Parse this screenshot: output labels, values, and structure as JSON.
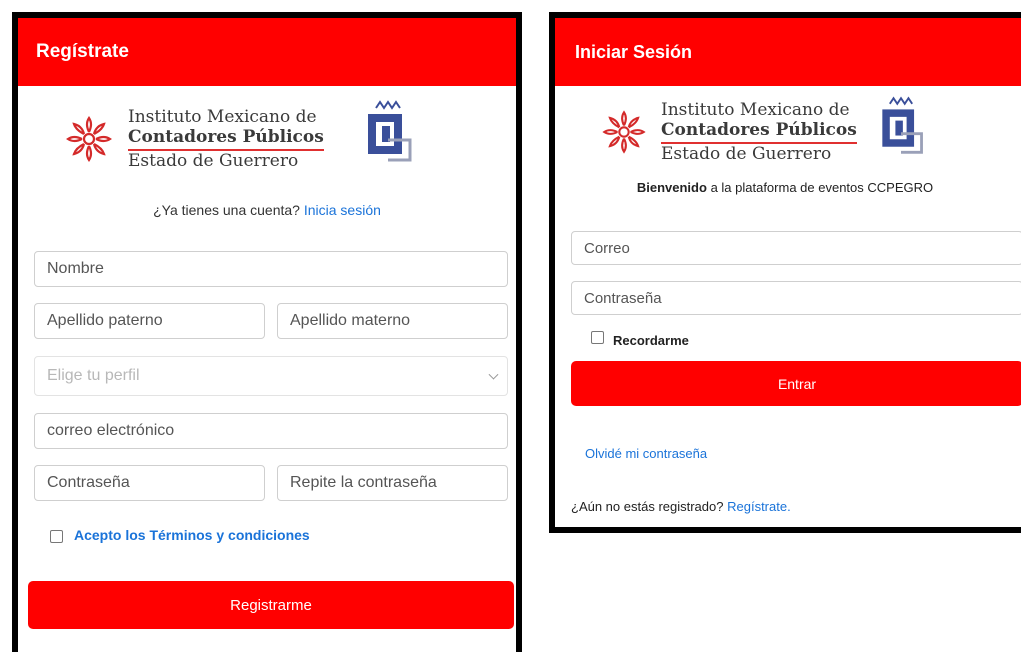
{
  "register": {
    "title": "Regístrate",
    "logo": {
      "line1": "Instituto Mexicano de",
      "line2": "Contadores Públicos",
      "line3": "Estado de Guerrero"
    },
    "have_account_text": "¿Ya tienes una cuenta?",
    "login_link": "Inicia sesión",
    "name_placeholder": "Nombre",
    "paternal_placeholder": "Apellido paterno",
    "maternal_placeholder": "Apellido materno",
    "profile_select": "Elige tu perfil",
    "email_placeholder": "correo electrónico",
    "password_placeholder": "Contraseña",
    "repeat_password_placeholder": "Repite la contraseña",
    "terms_label": "Acepto los Términos y condiciones",
    "submit_label": "Registrarme"
  },
  "login": {
    "title": "Iniciar Sesión",
    "logo": {
      "line1": "Instituto Mexicano de",
      "line2": "Contadores Públicos",
      "line3": "Estado de Guerrero"
    },
    "welcome_bold": "Bienvenido",
    "welcome_rest": "a la plataforma de eventos CCPEGRO",
    "email_placeholder": "Correo",
    "password_placeholder": "Contraseña",
    "remember_label": "Recordarme",
    "submit_label": "Entrar",
    "forgot_link": "Olvidé mi contraseña",
    "not_registered_text": "¿Aún no estás registrado?",
    "register_link": "Regístrate."
  },
  "colors": {
    "accent": "#ff0000",
    "link": "#1a73d9",
    "frame": "#000000"
  }
}
